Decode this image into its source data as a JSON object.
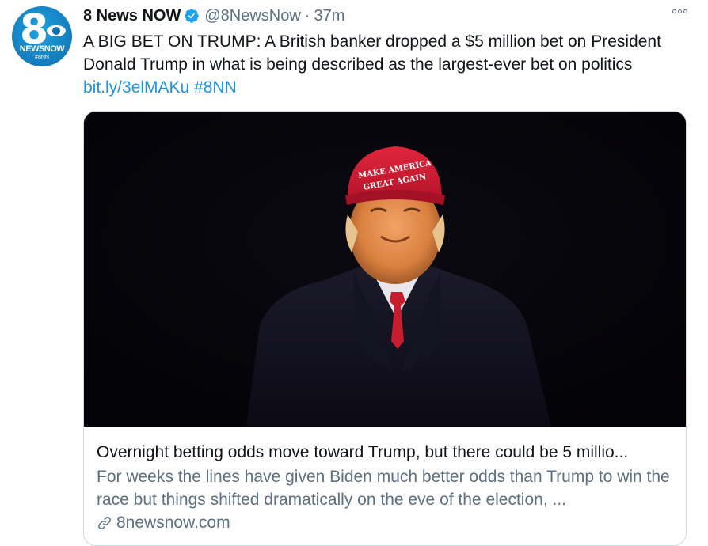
{
  "avatar": {
    "logo_number": "8",
    "logo_brand": "NEWSNOW",
    "logo_tag": "#8NN"
  },
  "author": {
    "name": "8 News NOW",
    "handle": "@8NewsNow",
    "separator": "·",
    "time": "37m"
  },
  "tweet": {
    "text": "A BIG BET ON TRUMP: A British banker dropped a $5 million bet on President Donald Trump in what is being described as the largest-ever bet on politics ",
    "link": "bit.ly/3elMAKu",
    "hashtag": "#8NN"
  },
  "card": {
    "hat_line1": "MAKE AMERICA",
    "hat_line2": "GREAT AGAIN",
    "title": "Overnight betting odds move toward Trump, but there could be 5 millio...",
    "description": "For weeks the lines have given Biden much better odds than Trump to win the race but things shifted dramatically on the eve of the election, ...",
    "domain": "8newsnow.com"
  },
  "icons": {
    "verified": "verified-badge-icon",
    "more": "more-options-icon",
    "link": "link-icon"
  },
  "colors": {
    "link": "#1b95e0",
    "secondary_text": "#5b7083",
    "verified": "#1da1f2",
    "avatar": "#1583c4"
  }
}
